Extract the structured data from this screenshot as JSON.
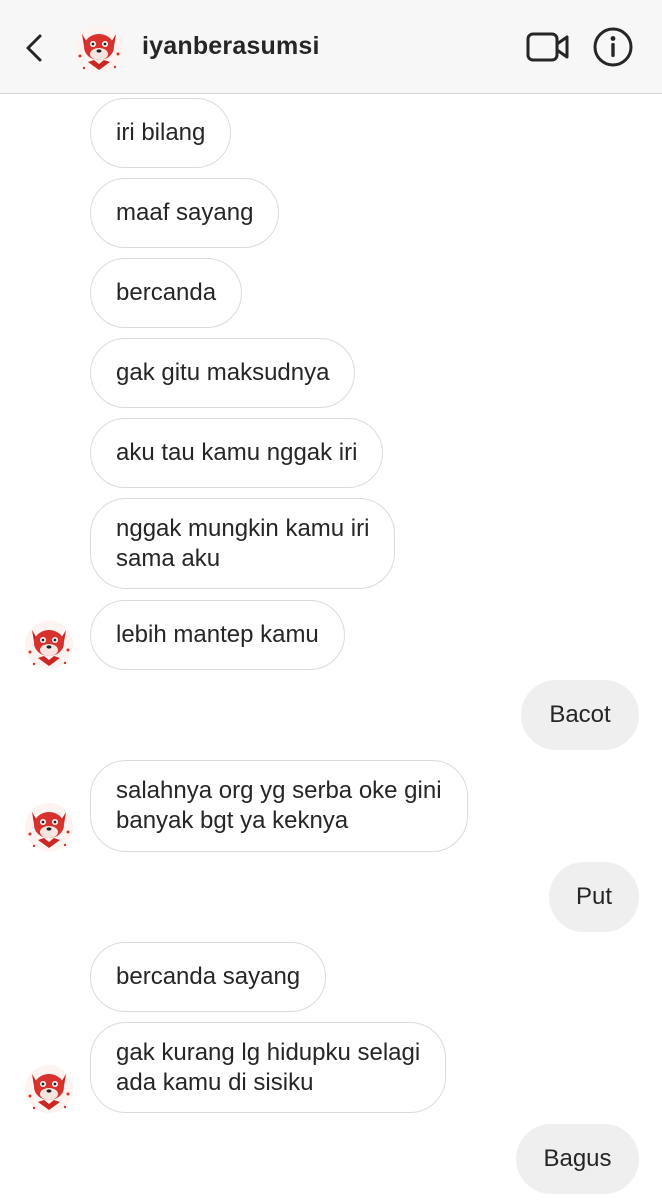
{
  "header": {
    "username": "iyanberasumsi",
    "back_icon": "chevron-left-icon",
    "video_icon": "video-camera-icon",
    "info_icon": "info-icon"
  },
  "messages": [
    {
      "sender": "them",
      "text": "iri bilang"
    },
    {
      "sender": "them",
      "text": "maaf sayang"
    },
    {
      "sender": "them",
      "text": "bercanda"
    },
    {
      "sender": "them",
      "text": "gak gitu maksudnya"
    },
    {
      "sender": "them",
      "text": "aku tau kamu nggak iri"
    },
    {
      "sender": "them",
      "lines": [
        "nggak mungkin kamu iri",
        "sama aku"
      ]
    },
    {
      "sender": "them",
      "text": "lebih mantep kamu"
    },
    {
      "sender": "me",
      "text": "Bacot"
    },
    {
      "sender": "them",
      "lines": [
        "salahnya org yg serba oke gini",
        "banyak bgt ya keknya"
      ]
    },
    {
      "sender": "me",
      "text": "Put"
    },
    {
      "sender": "them",
      "text": "bercanda sayang"
    },
    {
      "sender": "them",
      "lines": [
        "gak kurang lg hidupku selagi",
        "ada kamu di sisiku"
      ]
    },
    {
      "sender": "me",
      "text": "Bagus"
    }
  ],
  "colors": {
    "header_bg": "#f7f7f7",
    "incoming_bubble_border": "#dbdbdb",
    "outgoing_bubble_bg": "#efefef",
    "text": "#262626",
    "avatar_red": "#d8322f"
  }
}
